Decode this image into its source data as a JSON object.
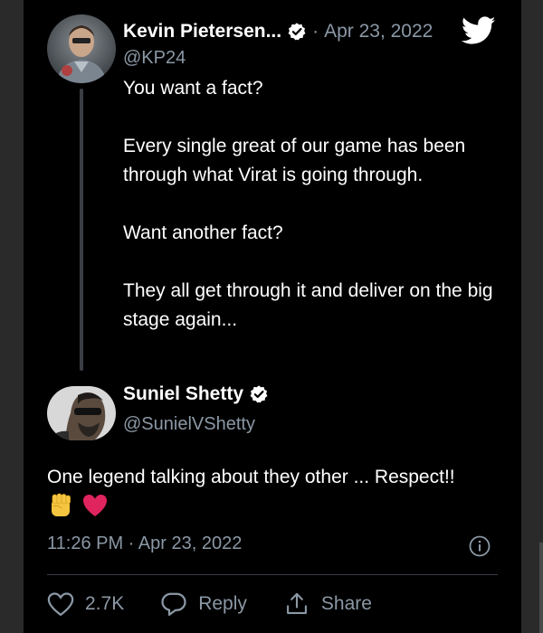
{
  "quoted_tweet": {
    "author_name": "Kevin Pietersen...",
    "handle": "@KP24",
    "date": "Apr 23, 2022",
    "separator": "·",
    "paragraphs": [
      "You want a fact?",
      "Every single great of our game has been through what Virat is going through.",
      "Want another fact?",
      "They all get through it and deliver on the big stage again..."
    ]
  },
  "reply_tweet": {
    "author_name": "Suniel Shetty",
    "handle": "@SunielVShetty",
    "text": "One legend talking about they other ... Respect!!",
    "emojis": [
      "raised-fist-emoji",
      "red-heart-emoji"
    ],
    "timestamp": "11:26 PM · Apr 23, 2022"
  },
  "actions": {
    "like_count": "2.7K",
    "reply_label": "Reply",
    "share_label": "Share"
  },
  "colors": {
    "background": "#000000",
    "text": "#ffffff",
    "secondary": "#8b98a5",
    "divider": "#3a3f44",
    "heart": "#e0245e",
    "fist": "#f5c542"
  },
  "icons": {
    "verified": "verified-badge-icon",
    "twitter": "twitter-bird-icon",
    "info": "info-icon",
    "like": "heart-outline-icon",
    "reply": "speech-bubble-icon",
    "share": "share-icon"
  }
}
